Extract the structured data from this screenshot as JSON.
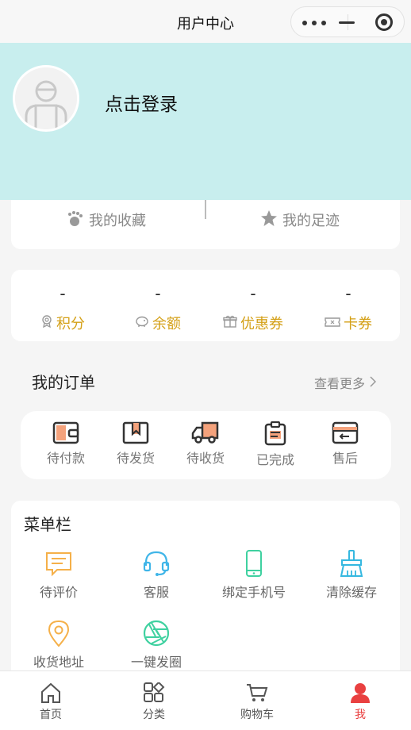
{
  "header": {
    "title": "用户中心"
  },
  "profile": {
    "login_label": "点击登录"
  },
  "favorites": {
    "collect_label": "我的收藏",
    "footprint_label": "我的足迹"
  },
  "stats": [
    {
      "value": "-",
      "label": "积分",
      "icon": "badge-icon"
    },
    {
      "value": "-",
      "label": "余额",
      "icon": "piggy-bank-icon"
    },
    {
      "value": "-",
      "label": "优惠券",
      "icon": "gift-icon"
    },
    {
      "value": "-",
      "label": "卡券",
      "icon": "ticket-icon"
    }
  ],
  "orders": {
    "title": "我的订单",
    "more_label": "查看更多",
    "items": [
      {
        "label": "待付款",
        "icon": "wallet-icon"
      },
      {
        "label": "待发货",
        "icon": "package-icon"
      },
      {
        "label": "待收货",
        "icon": "truck-icon"
      },
      {
        "label": "已完成",
        "icon": "clipboard-icon"
      },
      {
        "label": "售后",
        "icon": "return-card-icon"
      }
    ]
  },
  "menu": {
    "title": "菜单栏",
    "items": [
      {
        "label": "待评价",
        "icon": "comment-icon"
      },
      {
        "label": "客服",
        "icon": "headset-icon"
      },
      {
        "label": "绑定手机号",
        "icon": "phone-icon"
      },
      {
        "label": "清除缓存",
        "icon": "broom-icon"
      },
      {
        "label": "收货地址",
        "icon": "location-pin-icon"
      },
      {
        "label": "一键发圈",
        "icon": "shutter-icon"
      }
    ]
  },
  "tabbar": {
    "items": [
      {
        "label": "首页",
        "icon": "home-icon"
      },
      {
        "label": "分类",
        "icon": "category-icon"
      },
      {
        "label": "购物车",
        "icon": "cart-icon"
      },
      {
        "label": "我",
        "icon": "user-icon"
      }
    ],
    "active_color": "#e94040"
  },
  "colors": {
    "hero_bg": "#c8eeee",
    "stat_label": "#d4a017",
    "accent_orange": "#f4a27c"
  }
}
